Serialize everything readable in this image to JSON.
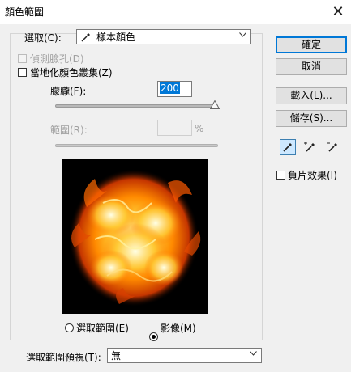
{
  "dialog": {
    "title": "顏色範圍"
  },
  "select": {
    "label": "選取(C):",
    "value": "樣本顏色"
  },
  "options": {
    "detect_faces_label": "偵測臉孔(D)",
    "localized_label": "當地化顏色叢集(Z)"
  },
  "fuzziness": {
    "label": "朦朧(F):",
    "value": "200"
  },
  "range": {
    "label": "範圍(R):",
    "unit": "%"
  },
  "radios": {
    "selection_label": "選取範圍(E)",
    "image_label": "影像(M)",
    "selected": "image"
  },
  "preview_select": {
    "label": "選取範圍預視(T):",
    "value": "無"
  },
  "buttons": {
    "ok": "確定",
    "cancel": "取消",
    "load": "載入(L)...",
    "save": "儲存(S)..."
  },
  "invert": {
    "label": "負片效果(I)"
  },
  "tools": [
    "eyedropper-icon",
    "eyedropper-plus-icon",
    "eyedropper-minus-icon"
  ],
  "colors": {
    "accent": "#0078d7",
    "background": "#f0f0f0"
  }
}
